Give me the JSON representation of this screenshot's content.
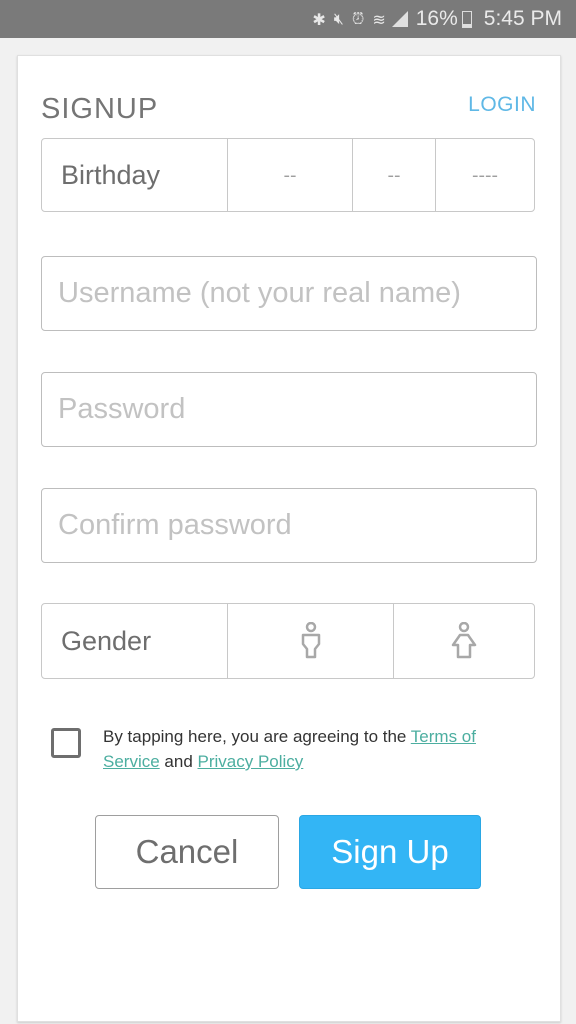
{
  "status_bar": {
    "icons": [
      "bluetooth-icon",
      "mute-icon",
      "alarm-icon",
      "wifi-icon",
      "signal-icon"
    ],
    "battery_percent": "16%",
    "battery_level": 0.16,
    "time": "5:45 PM"
  },
  "header": {
    "title": "SIGNUP",
    "login_link": "LOGIN"
  },
  "birthday": {
    "label": "Birthday",
    "month_placeholder": "--",
    "day_placeholder": "--",
    "year_placeholder": "----"
  },
  "fields": {
    "username_placeholder": "Username (not your real name)",
    "password_placeholder": "Password",
    "confirm_password_placeholder": "Confirm password"
  },
  "gender": {
    "label": "Gender",
    "options": [
      "male-icon",
      "female-icon"
    ]
  },
  "terms": {
    "text_before": "By tapping here, you are agreeing to the ",
    "tos_link": "Terms of Service",
    "text_middle": " and ",
    "privacy_link": "Privacy Policy",
    "checked": false
  },
  "buttons": {
    "cancel": "Cancel",
    "signup": "Sign Up"
  },
  "colors": {
    "accent": "#33b5f5",
    "link": "#4caea0",
    "login": "#5fb8e6"
  }
}
